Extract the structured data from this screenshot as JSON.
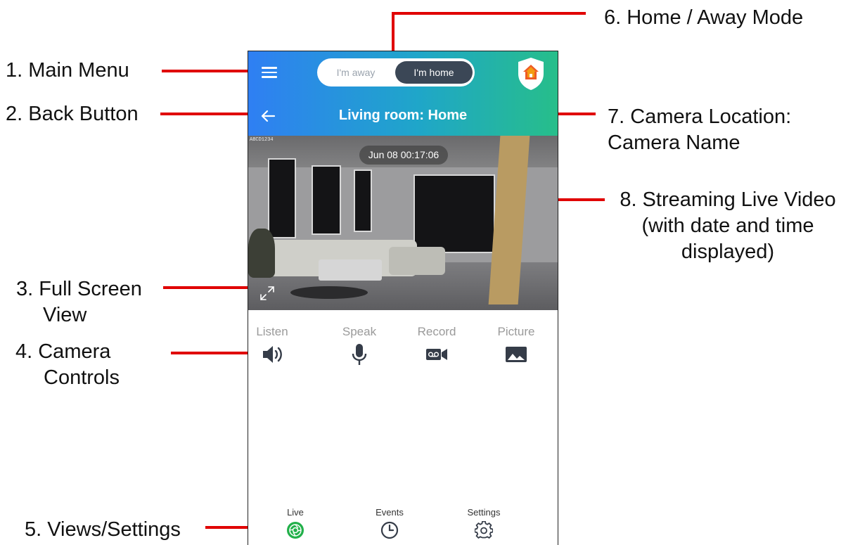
{
  "colors": {
    "header_gradient_start": "#2f7ff3",
    "header_gradient_end": "#27be8a",
    "annotation_line": "#e00000",
    "toggle_active": "#3b4756",
    "live_active": "#22b04a",
    "control_icon": "#353c48"
  },
  "header": {
    "menu_icon": "hamburger-menu-icon",
    "mode_toggle": {
      "away_label": "I'm away",
      "home_label": "I'm home",
      "selected": "home"
    },
    "brand_icon": "shield-house-icon",
    "back_icon": "arrow-left-icon",
    "camera_title": "Living room: Home"
  },
  "video": {
    "timestamp": "Jun 08 00:17:06",
    "osd_text": "ABCD1234",
    "fullscreen_icon": "expand-arrows-icon"
  },
  "controls": [
    {
      "label": "Listen",
      "icon": "speaker-icon"
    },
    {
      "label": "Speak",
      "icon": "microphone-icon"
    },
    {
      "label": "Record",
      "icon": "video-record-icon"
    },
    {
      "label": "Picture",
      "icon": "picture-icon"
    }
  ],
  "bottom_nav": [
    {
      "label": "Live",
      "icon": "live-icon",
      "active": true
    },
    {
      "label": "Events",
      "icon": "clock-icon",
      "active": false
    },
    {
      "label": "Settings",
      "icon": "gear-icon",
      "active": false
    }
  ],
  "annotations": {
    "main_menu": "1. Main Menu",
    "back_button": "2. Back Button",
    "full_screen_line1": "3. Full Screen",
    "full_screen_line2": "View",
    "camera_controls_line1": "4. Camera",
    "camera_controls_line2": "Controls",
    "views_settings": "5. Views/Settings",
    "home_away": "6. Home / Away Mode",
    "camera_location_line1": "7. Camera Location:",
    "camera_location_line2": "Camera Name",
    "streaming_line1": "8. Streaming Live Video",
    "streaming_line2": "(with date and time",
    "streaming_line3": "displayed)"
  }
}
